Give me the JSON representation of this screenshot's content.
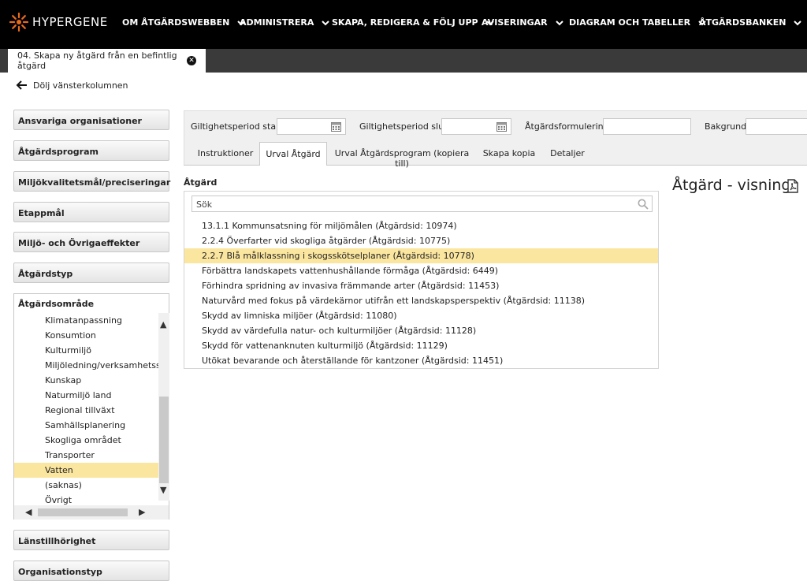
{
  "brand": {
    "logo_text": "HYPERGENE"
  },
  "nav": [
    "OM ÅTGÄRDSWEBBEN",
    "ADMINISTRERA",
    "SKAPA, REDIGERA & FÖLJ UPP",
    "AVISERINGAR",
    "DIAGRAM OCH TABELLER",
    "ÅTGÄRDSBANKEN"
  ],
  "doc_tab": {
    "label": "04. Skapa ny åtgärd från en befintlig åtgärd"
  },
  "hide_left_label": "Dölj vänsterkolumnen",
  "left_filters": {
    "top_buttons": [
      "Ansvariga organisationer",
      "Åtgärdsprogram",
      "Miljökvalitetsmål/preciseringar",
      "Etappmål",
      "Miljö- och Övrigaeffekter",
      "Åtgärdstyp"
    ],
    "open_panel": {
      "title": "Åtgärdsområde",
      "items": [
        "Klimatanpassning",
        "Konsumtion",
        "Kulturmiljö",
        "Miljöledning/verksamhetsstyrning",
        "Kunskap",
        "Naturmiljö land",
        "Regional tillväxt",
        "Samhällsplanering",
        "Skogliga området",
        "Transporter",
        "Vatten",
        "(saknas)",
        "Övrigt"
      ],
      "selected": "Vatten"
    },
    "bottom_buttons": [
      "Länstillhörighet",
      "Organisationstyp"
    ]
  },
  "filters": {
    "start_label": "Giltighetsperiod start:",
    "start_value": "",
    "end_label": "Giltighetsperiod slut:",
    "end_value": "",
    "formulering_label": "Åtgärdsformulering:",
    "formulering_value": "",
    "bakgrund_label": "Bakgrund:",
    "bakgrund_value": ""
  },
  "tabs": [
    {
      "label": "Instruktioner",
      "active": false
    },
    {
      "label": "Urval Åtgärd",
      "active": true
    },
    {
      "label": "Urval Åtgärdsprogram (kopiera till)",
      "active": false
    },
    {
      "label": "Skapa kopia",
      "active": false
    },
    {
      "label": "Detaljer",
      "active": false
    }
  ],
  "atgard": {
    "label": "Åtgärd",
    "search_placeholder": "Sök",
    "results": [
      "13.1.1 Kommunsatsning för miljömålen (Åtgärdsid: 10974)",
      "2.2.4 Överfarter vid skogliga åtgärder (Åtgärdsid: 10775)",
      "2.2.7 Blå målklassning i skogsskötselplaner (Åtgärdsid: 10778)",
      "Förbättra landskapets vattenhushållande förmåga (Åtgärdsid: 6449)",
      "Förhindra spridning av invasiva främmande arter (Åtgärdsid: 11453)",
      "Naturvård med fokus på värdekärnor utifrån ett landskapsperspektiv (Åtgärdsid: 11138)",
      "Skydd av limniska miljöer (Åtgärdsid: 11080)",
      "Skydd av värdefulla natur- och kulturmiljöer (Åtgärdsid: 11128)",
      "Skydd för vattenanknuten kulturmiljö (Åtgärdsid: 11129)",
      "Utökat bevarande och återställande för kantzoner (Åtgärdsid: 11451)"
    ],
    "selected_index": 2
  },
  "view": {
    "title": "Åtgärd - visning"
  },
  "colors": {
    "selection": "#fbe6a0",
    "topbar": "#000000",
    "logo_accent": "#e86a1a"
  }
}
